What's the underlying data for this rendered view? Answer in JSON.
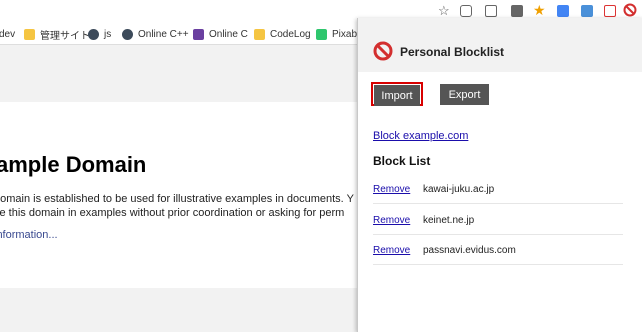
{
  "bookmarks": [
    {
      "label": "dev",
      "icon": "folder-icon"
    },
    {
      "label": "管理サイト",
      "icon": "folder-icon"
    },
    {
      "label": "js",
      "icon": "site-icon"
    },
    {
      "label": "Online C++",
      "icon": "site-icon"
    },
    {
      "label": "Online C",
      "icon": "lightning-icon"
    },
    {
      "label": "CodeLog",
      "icon": "folder-icon"
    },
    {
      "label": "Pixaba",
      "icon": "px-icon"
    }
  ],
  "page": {
    "heading": "ample Domain",
    "line1": "domain is established to be used for illustrative examples in documents. Y",
    "line2": "se this domain in examples without prior coordination or asking for perm",
    "more_link": "information..."
  },
  "popup": {
    "title": "Personal Blocklist",
    "import_label": "Import",
    "export_label": "Export",
    "block_link": "Block example.com",
    "list_title": "Block List",
    "remove_label": "Remove",
    "domains": [
      "kawai-juku.ac.jp",
      "keinet.ne.jp",
      "passnavi.evidus.com"
    ]
  },
  "colors": {
    "import_highlight": "#d80000",
    "button_bg": "#555555",
    "link": "#1a0dab",
    "block_icon": "#d32f2f"
  }
}
